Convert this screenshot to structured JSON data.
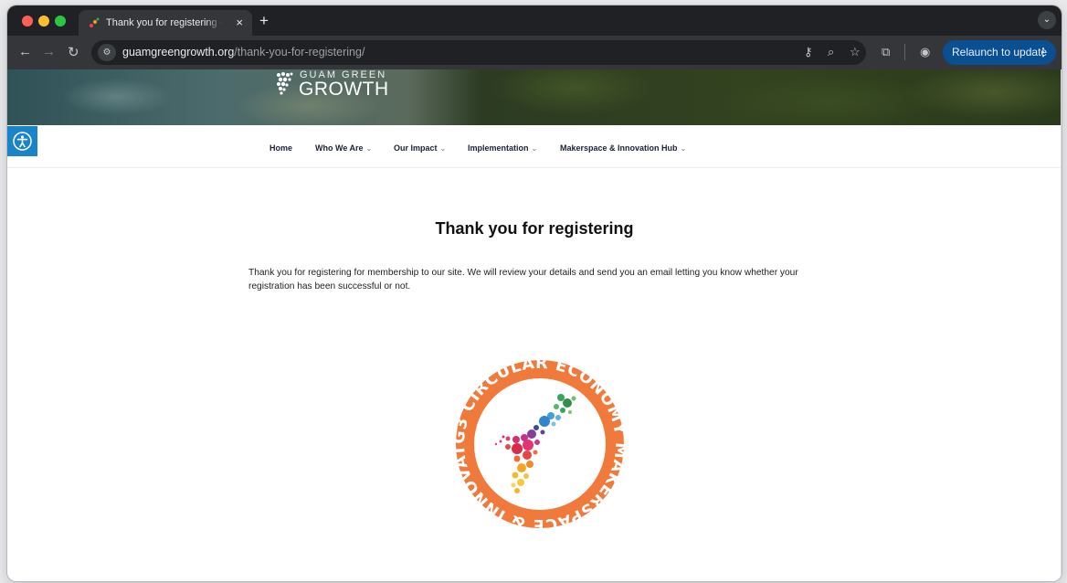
{
  "browser": {
    "tab_title": "Thank you for registering - Guam Green Growth",
    "tab_close": "×",
    "new_tab": "+",
    "url_host": "guamgreengrowth.org",
    "url_path": "/thank-you-for-registering/",
    "relaunch_label": "Relaunch to update",
    "icons": [
      "back-arrow-icon",
      "forward-arrow-icon",
      "reload-icon",
      "site-info-icon",
      "password-key-icon",
      "zoom-icon",
      "bookmark-star-icon",
      "extensions-icon",
      "profile-icon",
      "menu-dots-icon"
    ]
  },
  "site": {
    "brand_top": "GUAM GREEN",
    "brand_main": "GROWTH",
    "nav": [
      {
        "label": "Home",
        "has_menu": false
      },
      {
        "label": "Who We Are",
        "has_menu": true
      },
      {
        "label": "Our Impact",
        "has_menu": true
      },
      {
        "label": "Implementation",
        "has_menu": true
      },
      {
        "label": "Makerspace & Innovation Hub",
        "has_menu": true
      }
    ]
  },
  "content": {
    "heading": "Thank you for registering",
    "paragraph": "Thank you for registering for membership to our site. We will review your details and send you an email letting you know whether your registration has been successful or not."
  },
  "emblem": {
    "ring_text": "G3 CIRCULAR ECONOMY MAKERSPACE & INNOVATION HUB",
    "ring_color": "#f07a3c"
  },
  "colors": {
    "accessibility_button": "#1b84c9",
    "relaunch_button": "#0b4f93"
  }
}
